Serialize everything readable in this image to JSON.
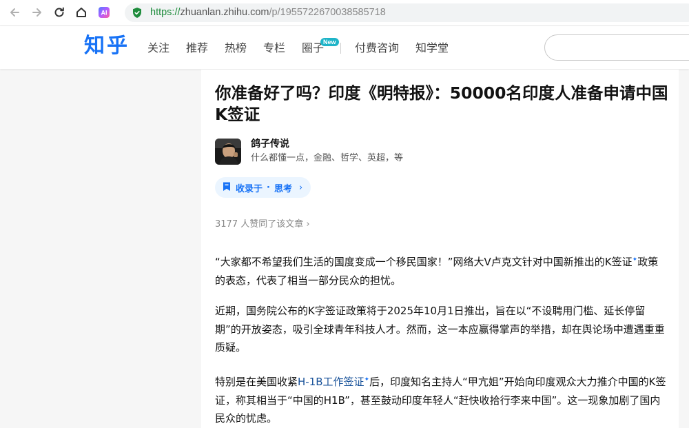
{
  "browser": {
    "url_protocol": "https://",
    "url_host": "zhuanlan.zhihu.com",
    "url_path": "/p/1955722670038585718"
  },
  "header": {
    "logo": "知乎",
    "nav": [
      "关注",
      "推荐",
      "热榜",
      "专栏",
      "圈子",
      "付费咨询",
      "知学堂"
    ],
    "new_badge": "New",
    "search_placeholder": ""
  },
  "article": {
    "title": "你准备好了吗？印度《明特报》：50000名印度人准备申请中国K签证",
    "author_name": "鸽子传说",
    "author_bio": "什么都懂一点，金融、哲学、英超，等",
    "collection_prefix": "收录于",
    "collection_dot": "·",
    "collection_name": "思考",
    "collection_chevron": "›",
    "likes": "3177 人赞同了该文章",
    "likes_chevron": "›",
    "p1_a": "“大家都不希望我们生活的国度变成一个移民国家！”网络大V卢克文针对中国新推出的",
    "p1_kw": "K签证",
    "p1_b": "政策的表态，代表了相当一部分民众的担忧。",
    "p2": "近期，国务院公布的K字签证政策将于2025年10月1日推出，旨在以“不设聘用门槛、延长停留期”的开放姿态，吸引全球青年科技人才。然而，这一本应赢得掌声的举措，却在舆论场中遭遇重重质疑。",
    "p3_a": "特别是在美国收紧",
    "p3_kw": "H-1B工作签证",
    "p3_b": "后，印度知名主持人“甲亢姐”开始向印度观众大力推介中国的K签证，称其相当于“中国的H1B”，甚至鼓动印度年轻人“赶快收拾行李来中国”。这一现象加剧了国内民众的忧虑。",
    "kw_mark": "✦"
  },
  "colors": {
    "brand": "#1772f6",
    "secure": "#1e8c3c"
  }
}
